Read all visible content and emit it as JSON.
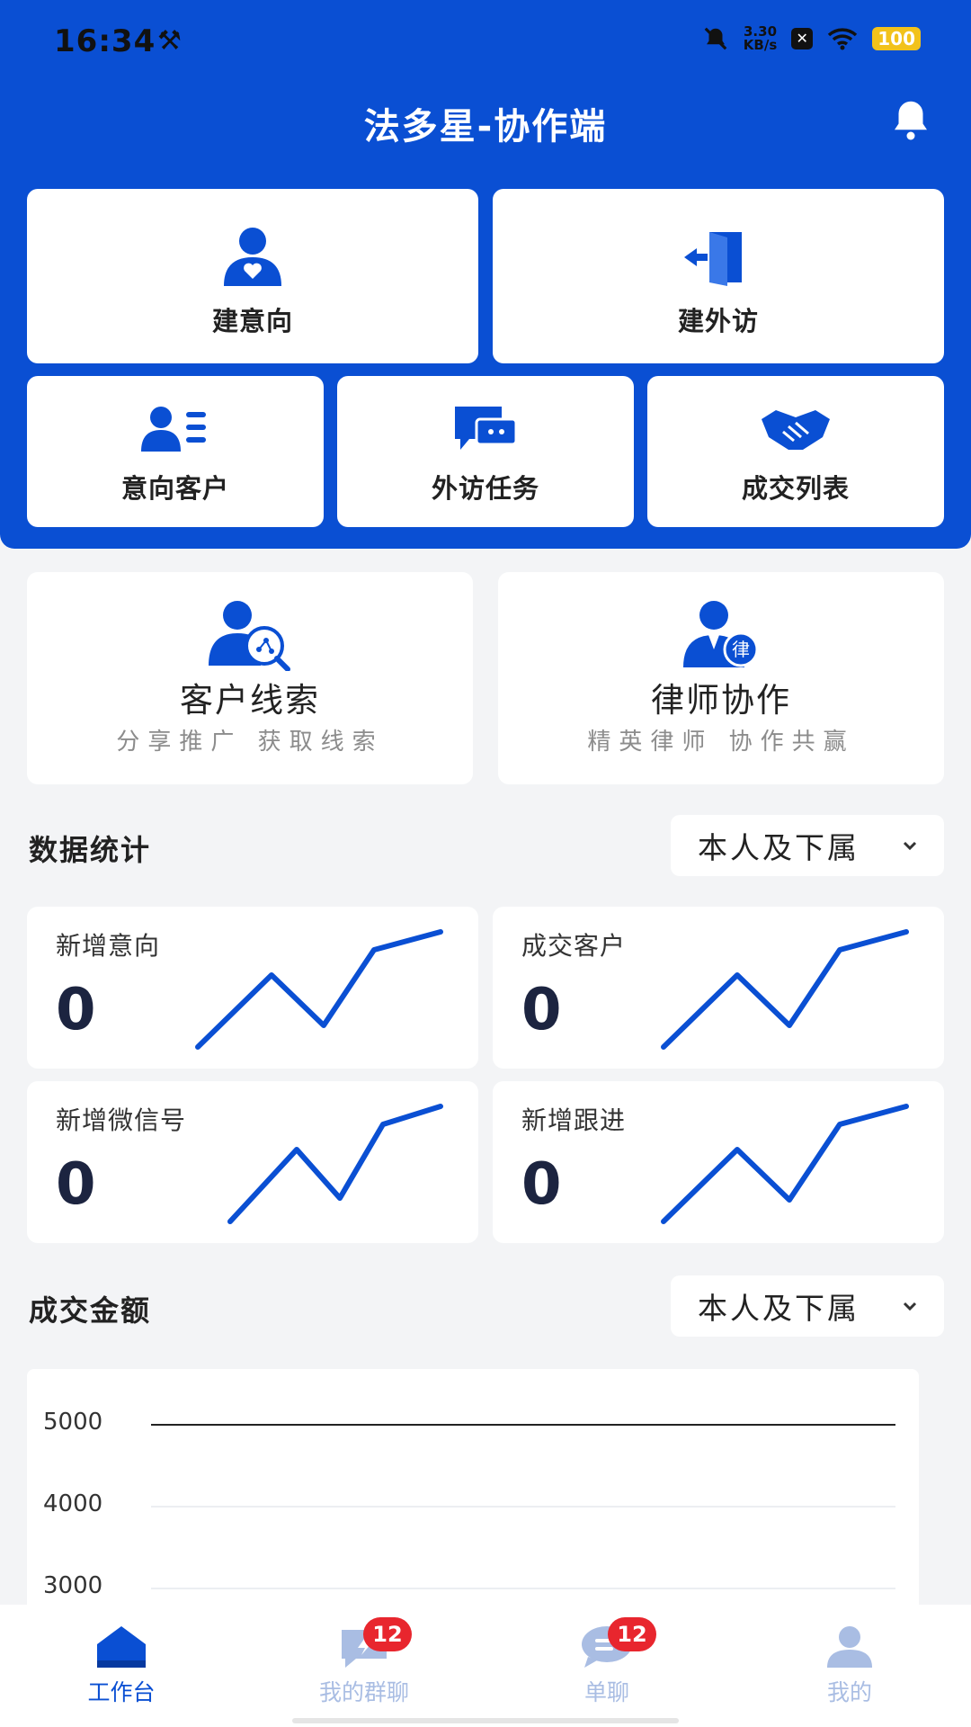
{
  "status_bar": {
    "time": "16:34",
    "net_speed_value": "3.30",
    "net_speed_unit": "KB/s",
    "battery": "100"
  },
  "header": {
    "title": "法多星-协作端"
  },
  "quick_actions": {
    "top": [
      {
        "label": "建意向",
        "icon": "user-heart-icon"
      },
      {
        "label": "建外访",
        "icon": "door-exit-icon"
      }
    ],
    "bottom": [
      {
        "label": "意向客户",
        "icon": "user-list-icon"
      },
      {
        "label": "外访任务",
        "icon": "chat-bubbles-icon"
      },
      {
        "label": "成交列表",
        "icon": "handshake-icon"
      }
    ]
  },
  "features": [
    {
      "title": "客户线索",
      "subtitle": "分享推广 获取线索",
      "icon": "user-share-search-icon"
    },
    {
      "title": "律师协作",
      "subtitle": "精英律师 协作共赢",
      "icon": "lawyer-icon",
      "icon_badge": "律"
    }
  ],
  "data_stats": {
    "title": "数据统计",
    "filter": "本人及下属",
    "cards": [
      {
        "label": "新增意向",
        "value": "0"
      },
      {
        "label": "成交客户",
        "value": "0"
      },
      {
        "label": "新增微信号",
        "value": "0"
      },
      {
        "label": "新增跟进",
        "value": "0"
      }
    ]
  },
  "deal_amount": {
    "title": "成交金额",
    "filter": "本人及下属"
  },
  "chart_data": {
    "type": "line",
    "title": "",
    "xlabel": "",
    "ylabel": "",
    "y_tick_labels": [
      "5000",
      "4000",
      "3000"
    ],
    "ylim_visible": [
      3000,
      5000
    ],
    "grid": true,
    "series": []
  },
  "tabbar": {
    "tabs": [
      {
        "label": "工作台",
        "icon": "home-icon",
        "active": true
      },
      {
        "label": "我的群聊",
        "icon": "group-chat-icon",
        "badge": "12"
      },
      {
        "label": "单聊",
        "icon": "chat-icon",
        "badge": "12"
      },
      {
        "label": "我的",
        "icon": "profile-icon"
      }
    ]
  },
  "colors": {
    "primary": "#0a4fd3",
    "background": "#f3f4f6",
    "badge": "#e8262e",
    "inactive_tab": "#a9bde3"
  }
}
